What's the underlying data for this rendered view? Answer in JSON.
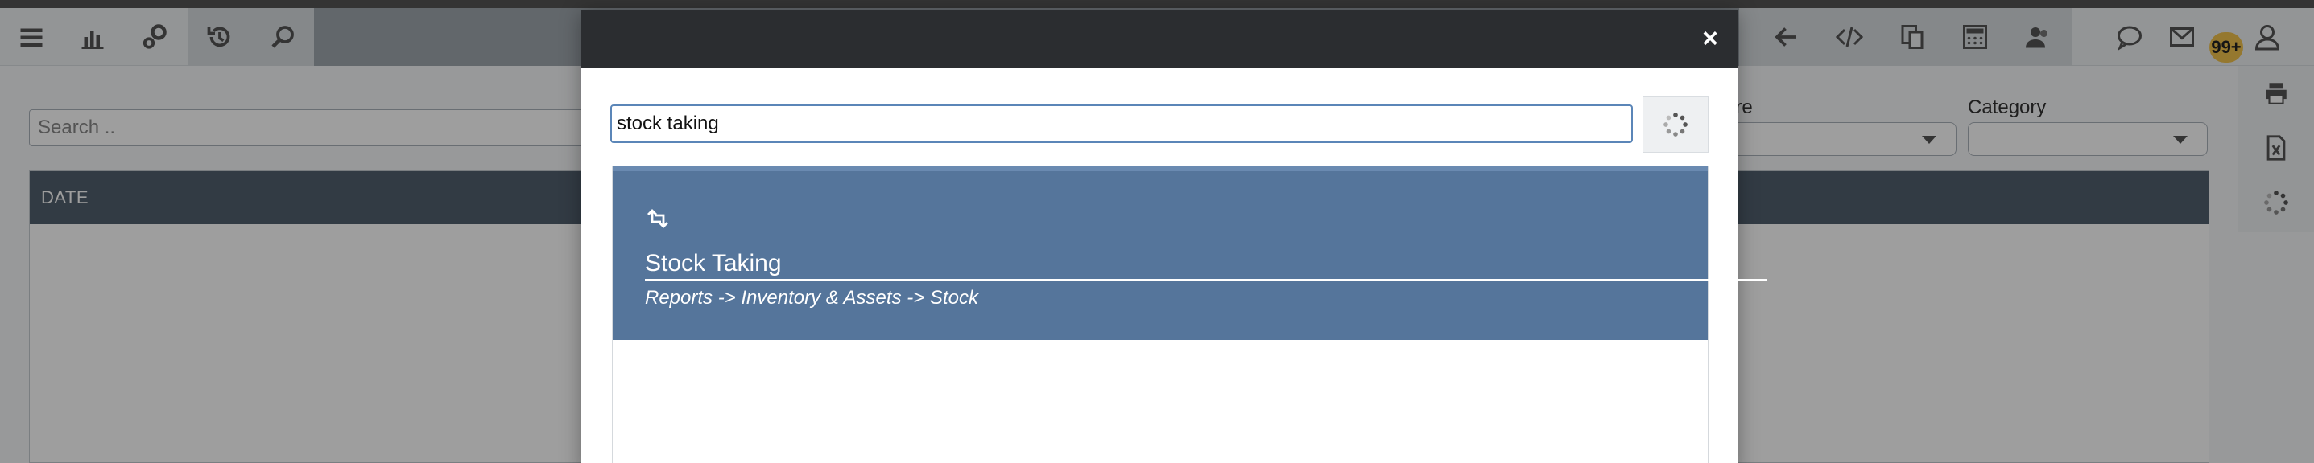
{
  "toolbar": {
    "left_icons": [
      "menu-icon",
      "bar-chart-icon",
      "gears-icon",
      "history-icon",
      "search-icon"
    ],
    "right_icons": [
      "back-arrow-icon",
      "code-icon",
      "copy-icon",
      "calculator-icon",
      "users-icon",
      "chat-icon",
      "mail-icon",
      "user-icon"
    ],
    "notification_count": "99+"
  },
  "background": {
    "search_placeholder": "Search ..",
    "filters": [
      {
        "label": "ore"
      },
      {
        "label": "Category"
      }
    ],
    "grid": {
      "columns": [
        "DATE"
      ]
    }
  },
  "side_tools": [
    "print-icon",
    "excel-icon",
    "spinner-icon"
  ],
  "modal": {
    "close_label": "×",
    "search_value": "stock taking",
    "results": [
      {
        "icon": "retweet-icon",
        "title": "Stock Taking",
        "path": "Reports -> Inventory & Assets -> Stock"
      }
    ]
  },
  "colors": {
    "modal_header": "#2b2d30",
    "result_bg": "#55759b",
    "grid_header": "#52606e",
    "badge": "#f0c24d"
  }
}
